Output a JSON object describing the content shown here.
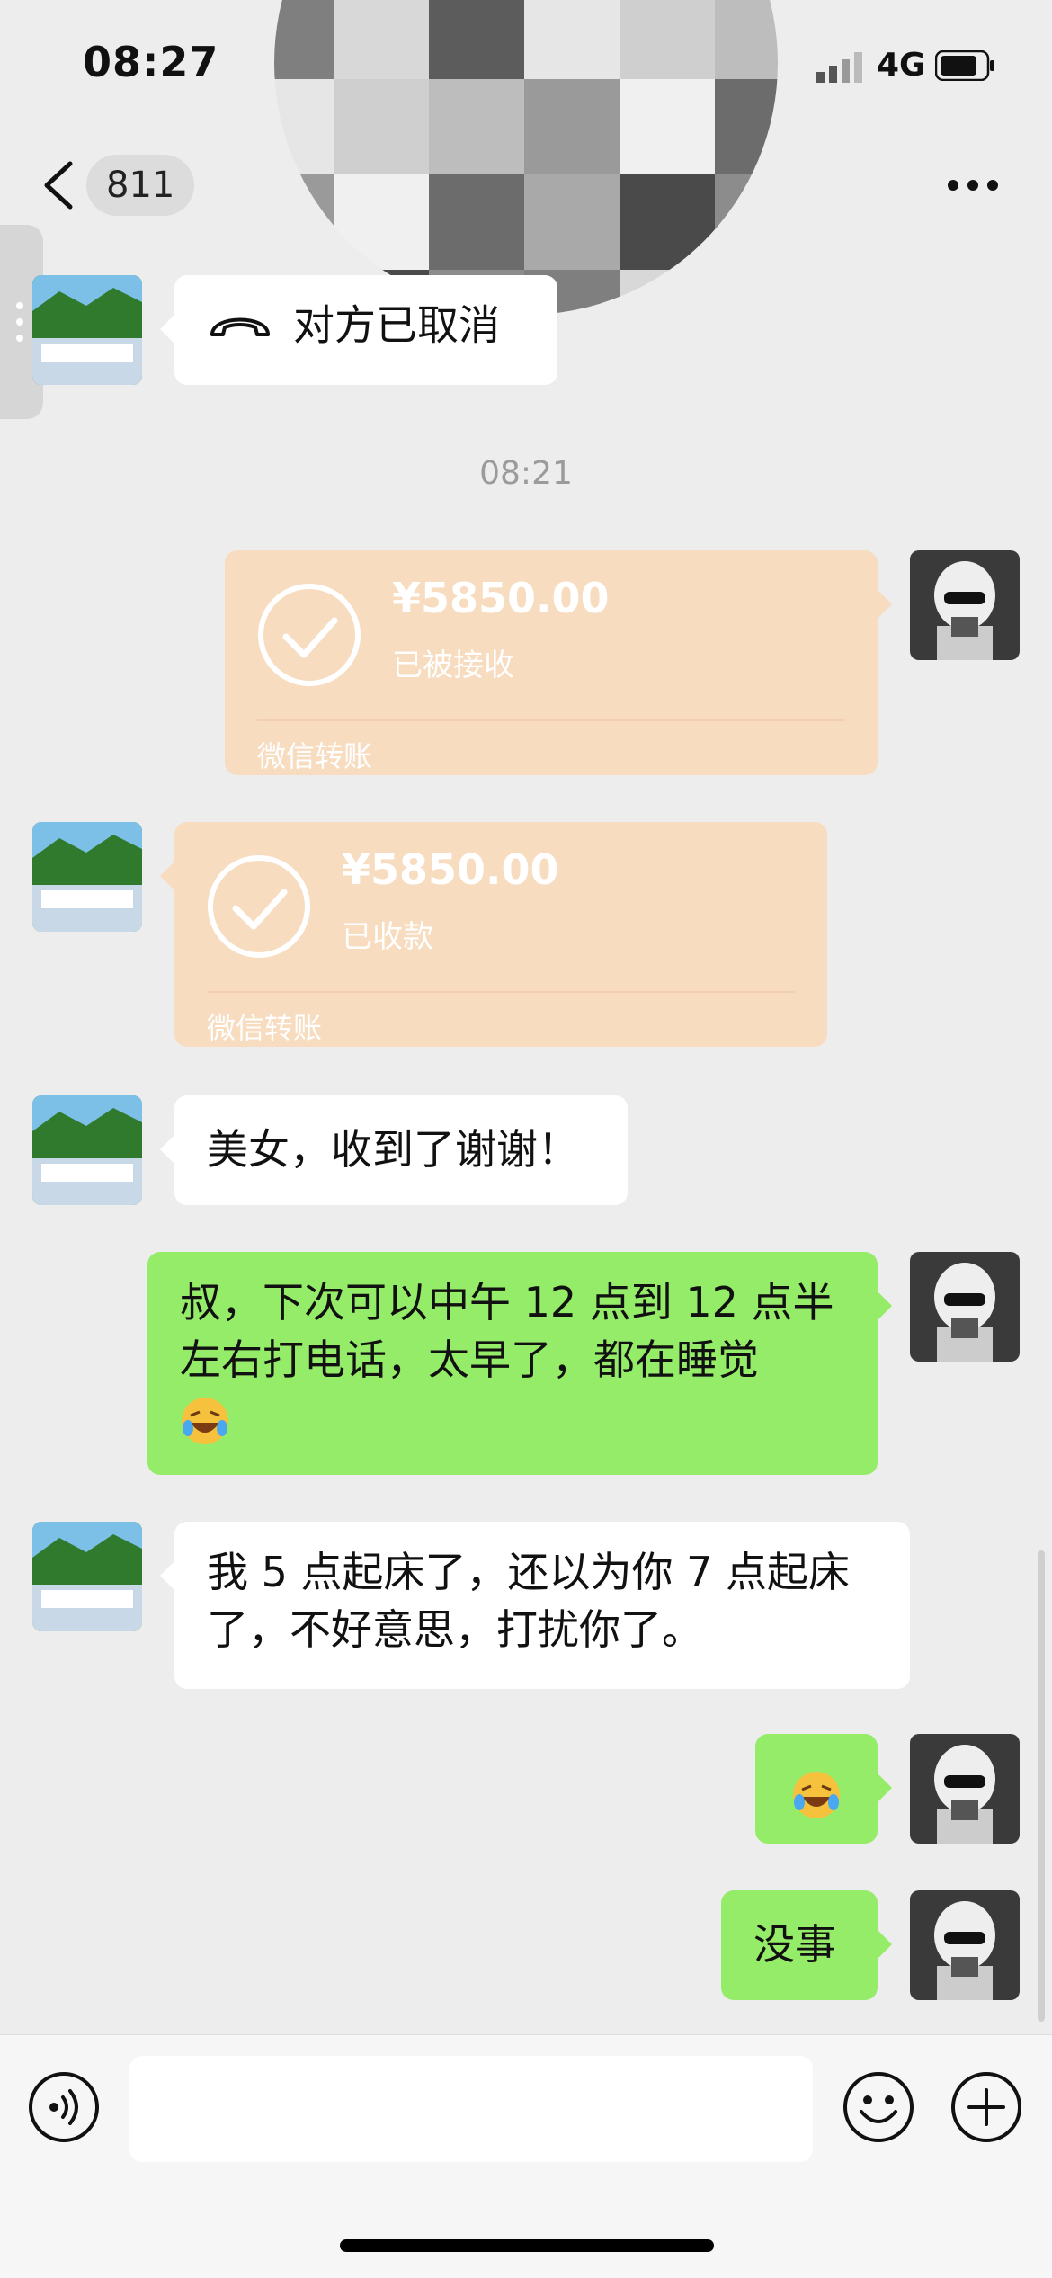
{
  "status_bar": {
    "time": "08:27",
    "network": "4G"
  },
  "header": {
    "contact_badge": "811"
  },
  "messages": [
    {
      "side": "left",
      "type": "call",
      "text": "对方已取消"
    },
    {
      "type": "timestamp",
      "text": "08:21"
    },
    {
      "side": "right",
      "type": "transfer",
      "amount": "¥5850.00",
      "status": "已被接收",
      "brand": "微信转账"
    },
    {
      "side": "left",
      "type": "transfer",
      "amount": "¥5850.00",
      "status": "已收款",
      "brand": "微信转账"
    },
    {
      "side": "left",
      "type": "text",
      "text": "美女，收到了谢谢！"
    },
    {
      "side": "right",
      "type": "text",
      "line1": "叔，下次可以中午 12 点到 12 点半",
      "line2": "左右打电话，太早了，都在睡觉"
    },
    {
      "side": "left",
      "type": "text",
      "line1": "我 5 点起床了，还以为你 7 点起床",
      "line2": "了，不好意思，打扰你了。"
    },
    {
      "side": "right",
      "type": "emoji"
    },
    {
      "side": "right",
      "type": "text",
      "text": "没事"
    }
  ],
  "icons": {
    "back": "chevron-left-icon",
    "more": "more-dots-icon",
    "call": "phone-hangup-icon",
    "voice": "voice-input-icon",
    "emoji": "emoji-icon",
    "plus": "plus-icon"
  },
  "colors": {
    "background": "#ededed",
    "sent_bubble": "#95ec69",
    "received_bubble": "#ffffff",
    "transfer": "#f7dcc0"
  }
}
